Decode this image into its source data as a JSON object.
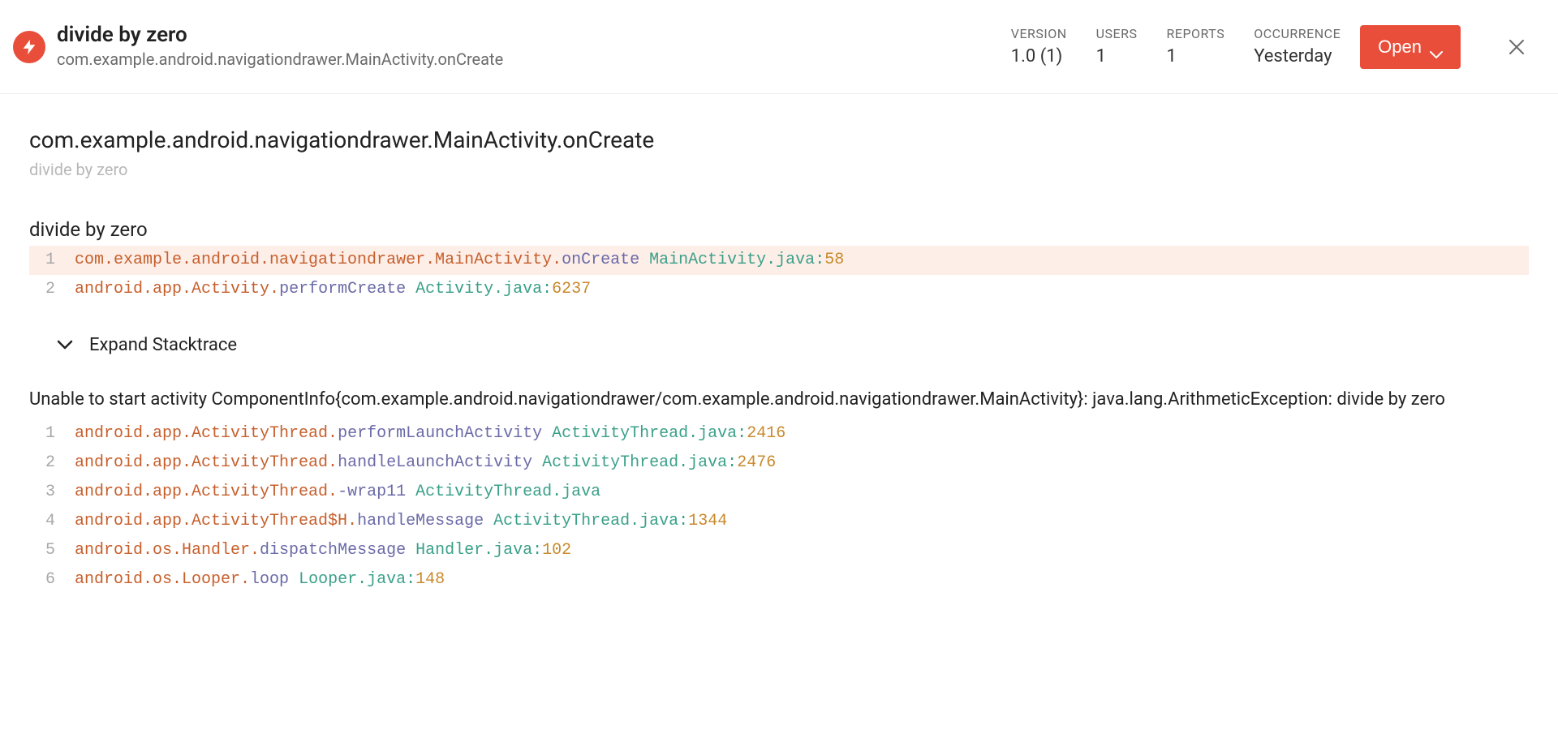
{
  "header": {
    "title": "divide by zero",
    "subtitle": "com.example.android.navigationdrawer.MainActivity.onCreate",
    "stats": [
      {
        "label": "VERSION",
        "value": "1.0 (1)"
      },
      {
        "label": "USERS",
        "value": "1"
      },
      {
        "label": "REPORTS",
        "value": "1"
      },
      {
        "label": "OCCURRENCE",
        "value": "Yesterday"
      }
    ],
    "open_button": "Open"
  },
  "section": {
    "title": "com.example.android.navigationdrawer.MainActivity.onCreate",
    "subtitle": "divide by zero"
  },
  "exception1": {
    "name": "divide by zero",
    "frames": [
      {
        "n": "1",
        "highlight": true,
        "pkg": "com.example.android.navigationdrawer.",
        "cls": "MainActivity.",
        "meth": "onCreate",
        "file": "MainActivity.java",
        "line": "58"
      },
      {
        "n": "2",
        "highlight": false,
        "pkg": "android.app.",
        "cls": "Activity.",
        "meth": "performCreate",
        "file": "Activity.java",
        "line": "6237"
      }
    ],
    "expand": "Expand Stacktrace"
  },
  "exception2": {
    "message": "Unable to start activity ComponentInfo{com.example.android.navigationdrawer/com.example.android.navigationdrawer.MainActivity}: java.lang.ArithmeticException: divide by zero",
    "frames": [
      {
        "n": "1",
        "pkg": "android.app.",
        "cls": "ActivityThread.",
        "meth": "performLaunchActivity",
        "file": "ActivityThread.java",
        "line": "2416"
      },
      {
        "n": "2",
        "pkg": "android.app.",
        "cls": "ActivityThread.",
        "meth": "handleLaunchActivity",
        "file": "ActivityThread.java",
        "line": "2476"
      },
      {
        "n": "3",
        "pkg": "android.app.",
        "cls": "ActivityThread.",
        "meth": "-wrap11",
        "file": "ActivityThread.java",
        "line": ""
      },
      {
        "n": "4",
        "pkg": "android.app.",
        "cls": "ActivityThread$H.",
        "meth": "handleMessage",
        "file": "ActivityThread.java",
        "line": "1344"
      },
      {
        "n": "5",
        "pkg": "android.os.",
        "cls": "Handler.",
        "meth": "dispatchMessage",
        "file": "Handler.java",
        "line": "102"
      },
      {
        "n": "6",
        "pkg": "android.os.",
        "cls": "Looper.",
        "meth": "loop",
        "file": "Looper.java",
        "line": "148"
      }
    ]
  }
}
